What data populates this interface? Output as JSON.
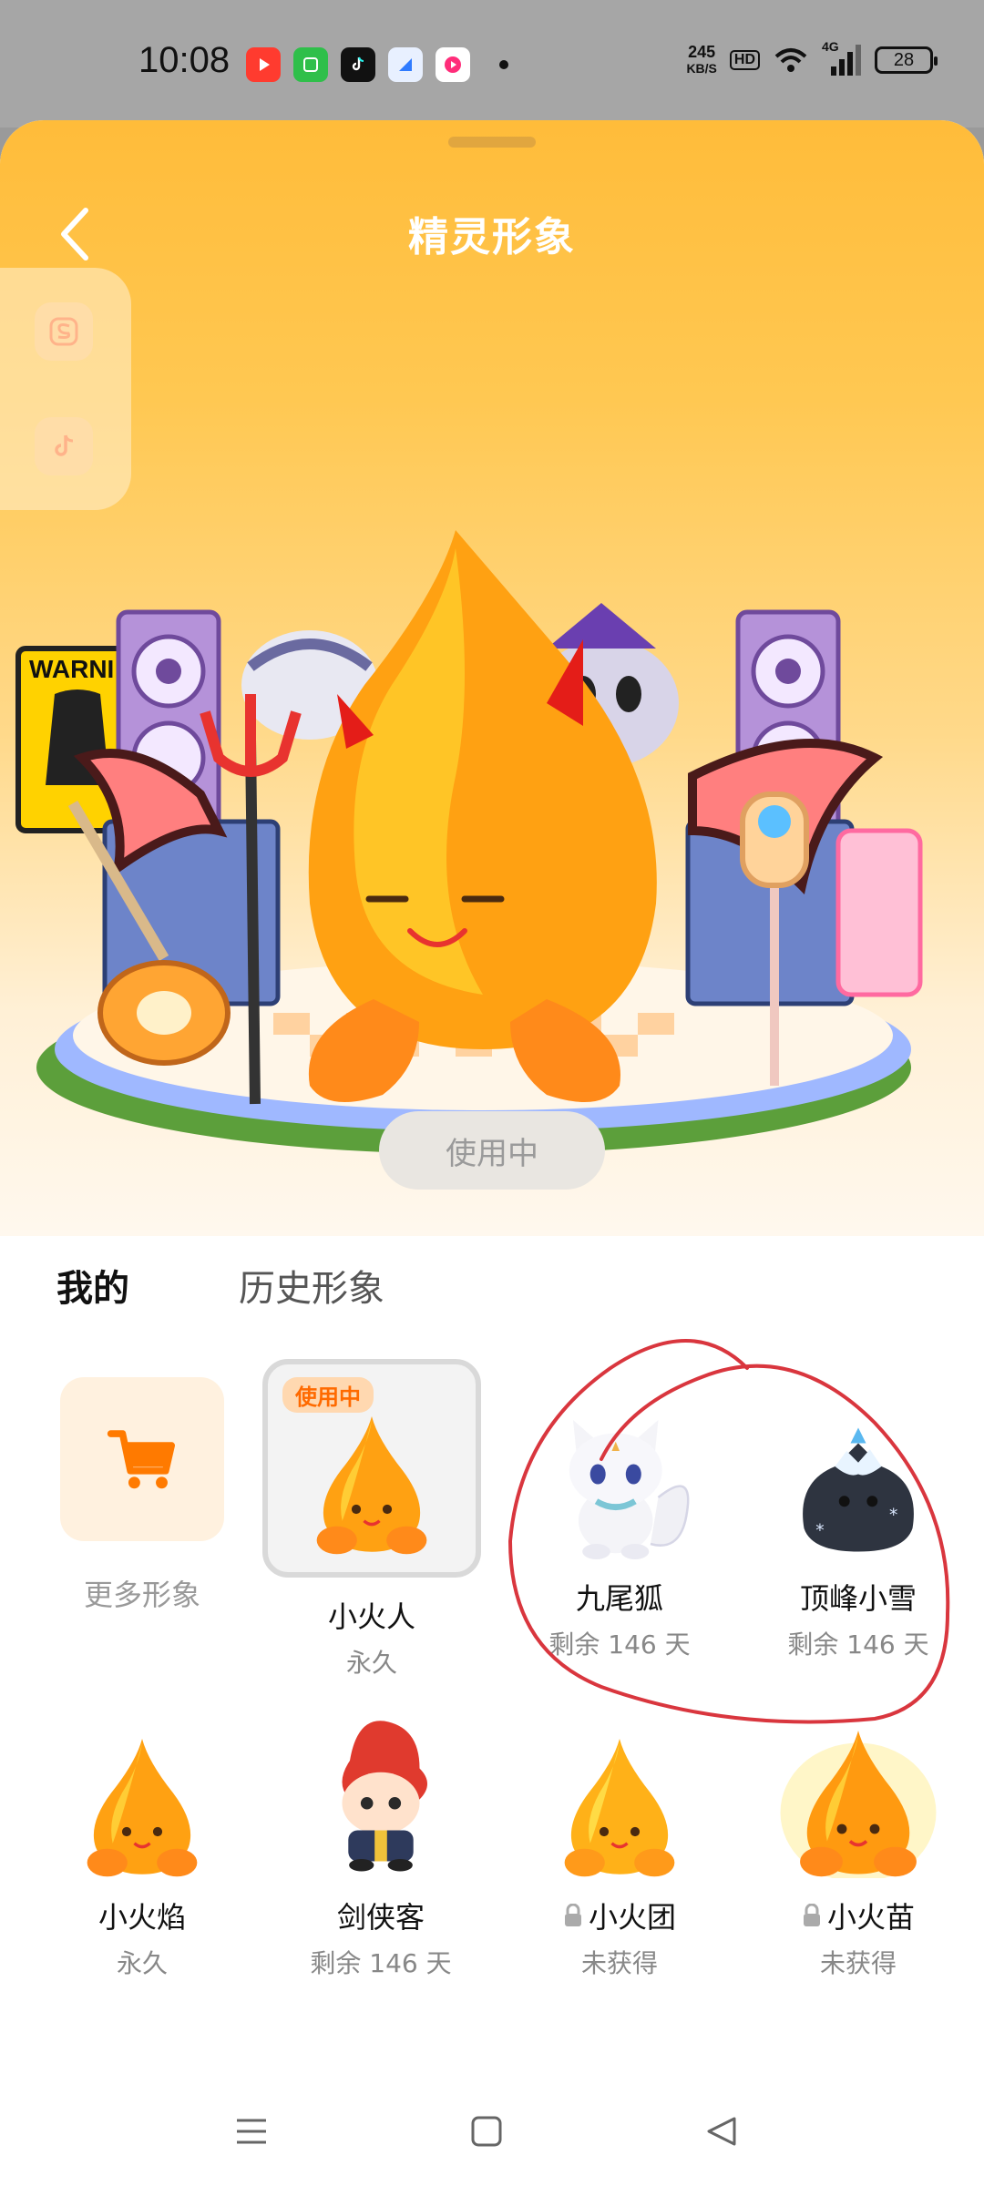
{
  "status": {
    "time": "10:08",
    "speed_value": "245",
    "speed_unit": "KB/S",
    "hd": "HD",
    "network": "4G",
    "battery": "28"
  },
  "header": {
    "title": "精灵形象"
  },
  "hero": {
    "use_button": "使用中"
  },
  "tabs": [
    {
      "label": "我的"
    },
    {
      "label": "历史形象"
    }
  ],
  "items": [
    {
      "name": "更多形象",
      "sub": ""
    },
    {
      "name": "小火人",
      "sub": "永久",
      "badge": "使用中"
    },
    {
      "name": "九尾狐",
      "sub": "剩余 146 天"
    },
    {
      "name": "顶峰小雪",
      "sub": "剩余 146 天"
    },
    {
      "name": "小火焰",
      "sub": "永久"
    },
    {
      "name": "剑侠客",
      "sub": "剩余 146 天"
    },
    {
      "name": "小火团",
      "sub": "未获得"
    },
    {
      "name": "小火苗",
      "sub": "未获得"
    }
  ],
  "colors": {
    "accent": "#ff7a00",
    "header_bg": "#ffbc3a",
    "annotation": "#d9363e"
  }
}
